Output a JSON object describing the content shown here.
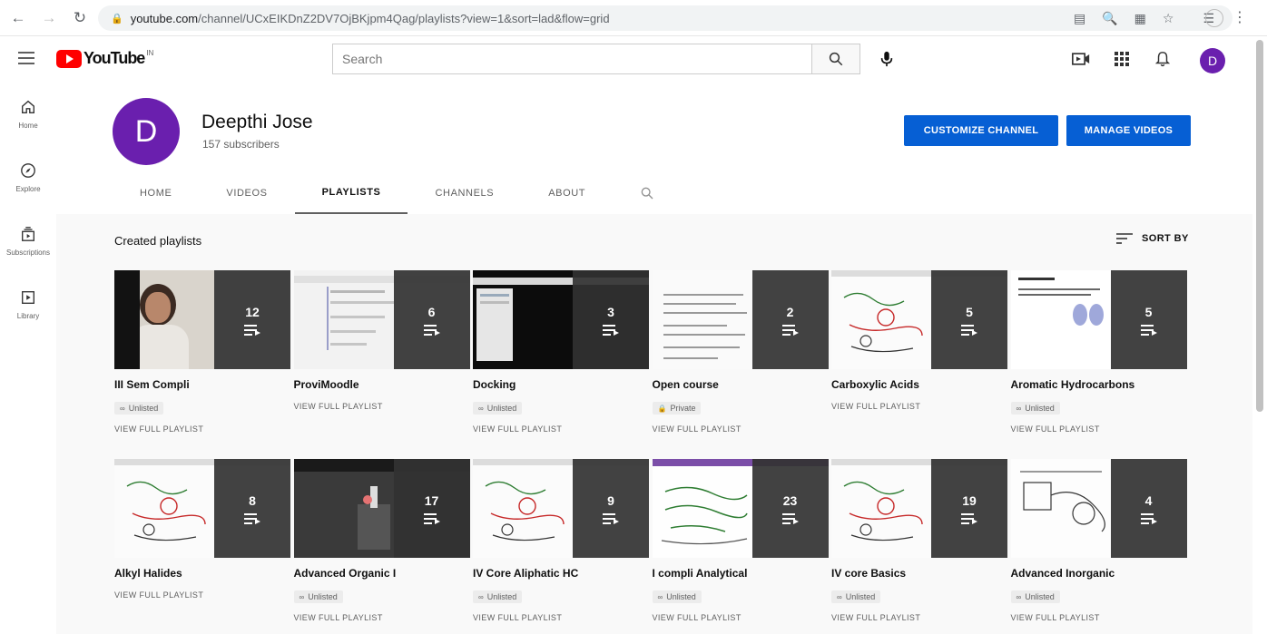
{
  "browser": {
    "url_domain": "youtube.com",
    "url_path": "/channel/UCxEIKDnZ2DV7OjBKjpm4Qag/playlists?view=1&sort=lad&flow=grid"
  },
  "header": {
    "logo_text": "YouTube",
    "logo_region": "IN",
    "search_placeholder": "Search",
    "avatar_letter": "D"
  },
  "sidebar": {
    "items": [
      {
        "label": "Home",
        "icon": "home-icon"
      },
      {
        "label": "Explore",
        "icon": "compass-icon"
      },
      {
        "label": "Subscriptions",
        "icon": "subscriptions-icon"
      },
      {
        "label": "Library",
        "icon": "library-icon"
      }
    ]
  },
  "channel": {
    "avatar_letter": "D",
    "name": "Deepthi Jose",
    "subscribers": "157 subscribers",
    "customize_label": "CUSTOMIZE CHANNEL",
    "manage_label": "MANAGE VIDEOS",
    "tabs": [
      "HOME",
      "VIDEOS",
      "PLAYLISTS",
      "CHANNELS",
      "ABOUT"
    ],
    "active_tab": "PLAYLISTS"
  },
  "section": {
    "title": "Created playlists",
    "sort_label": "SORT BY"
  },
  "playlists": [
    {
      "title": "III Sem Compli",
      "count": "12",
      "badge": "Unlisted",
      "action": "VIEW FULL PLAYLIST",
      "thumb": "person"
    },
    {
      "title": "ProviMoodle",
      "count": "6",
      "badge": "",
      "action": "VIEW FULL PLAYLIST",
      "thumb": "doc"
    },
    {
      "title": "Docking",
      "count": "3",
      "badge": "Unlisted",
      "action": "VIEW FULL PLAYLIST",
      "thumb": "dark"
    },
    {
      "title": "Open course",
      "count": "2",
      "badge": "Private",
      "action": "VIEW FULL PLAYLIST",
      "thumb": "text"
    },
    {
      "title": "Carboxylic Acids",
      "count": "5",
      "badge": "",
      "action": "VIEW FULL PLAYLIST",
      "thumb": "chem"
    },
    {
      "title": "Aromatic Hydrocarbons",
      "count": "5",
      "badge": "Unlisted",
      "action": "VIEW FULL PLAYLIST",
      "thumb": "slide"
    },
    {
      "title": "Alkyl Halides",
      "count": "8",
      "badge": "",
      "action": "VIEW FULL PLAYLIST",
      "thumb": "chem"
    },
    {
      "title": "Advanced Organic I",
      "count": "17",
      "badge": "Unlisted",
      "action": "VIEW FULL PLAYLIST",
      "thumb": "lab"
    },
    {
      "title": "IV Core Aliphatic HC",
      "count": "9",
      "badge": "Unlisted",
      "action": "VIEW FULL PLAYLIST",
      "thumb": "chem"
    },
    {
      "title": "I compli Analytical",
      "count": "23",
      "badge": "Unlisted",
      "action": "VIEW FULL PLAYLIST",
      "thumb": "green"
    },
    {
      "title": "IV core Basics",
      "count": "19",
      "badge": "Unlisted",
      "action": "VIEW FULL PLAYLIST",
      "thumb": "chem"
    },
    {
      "title": "Advanced Inorganic",
      "count": "4",
      "badge": "Unlisted",
      "action": "VIEW FULL PLAYLIST",
      "thumb": "sketch"
    }
  ]
}
